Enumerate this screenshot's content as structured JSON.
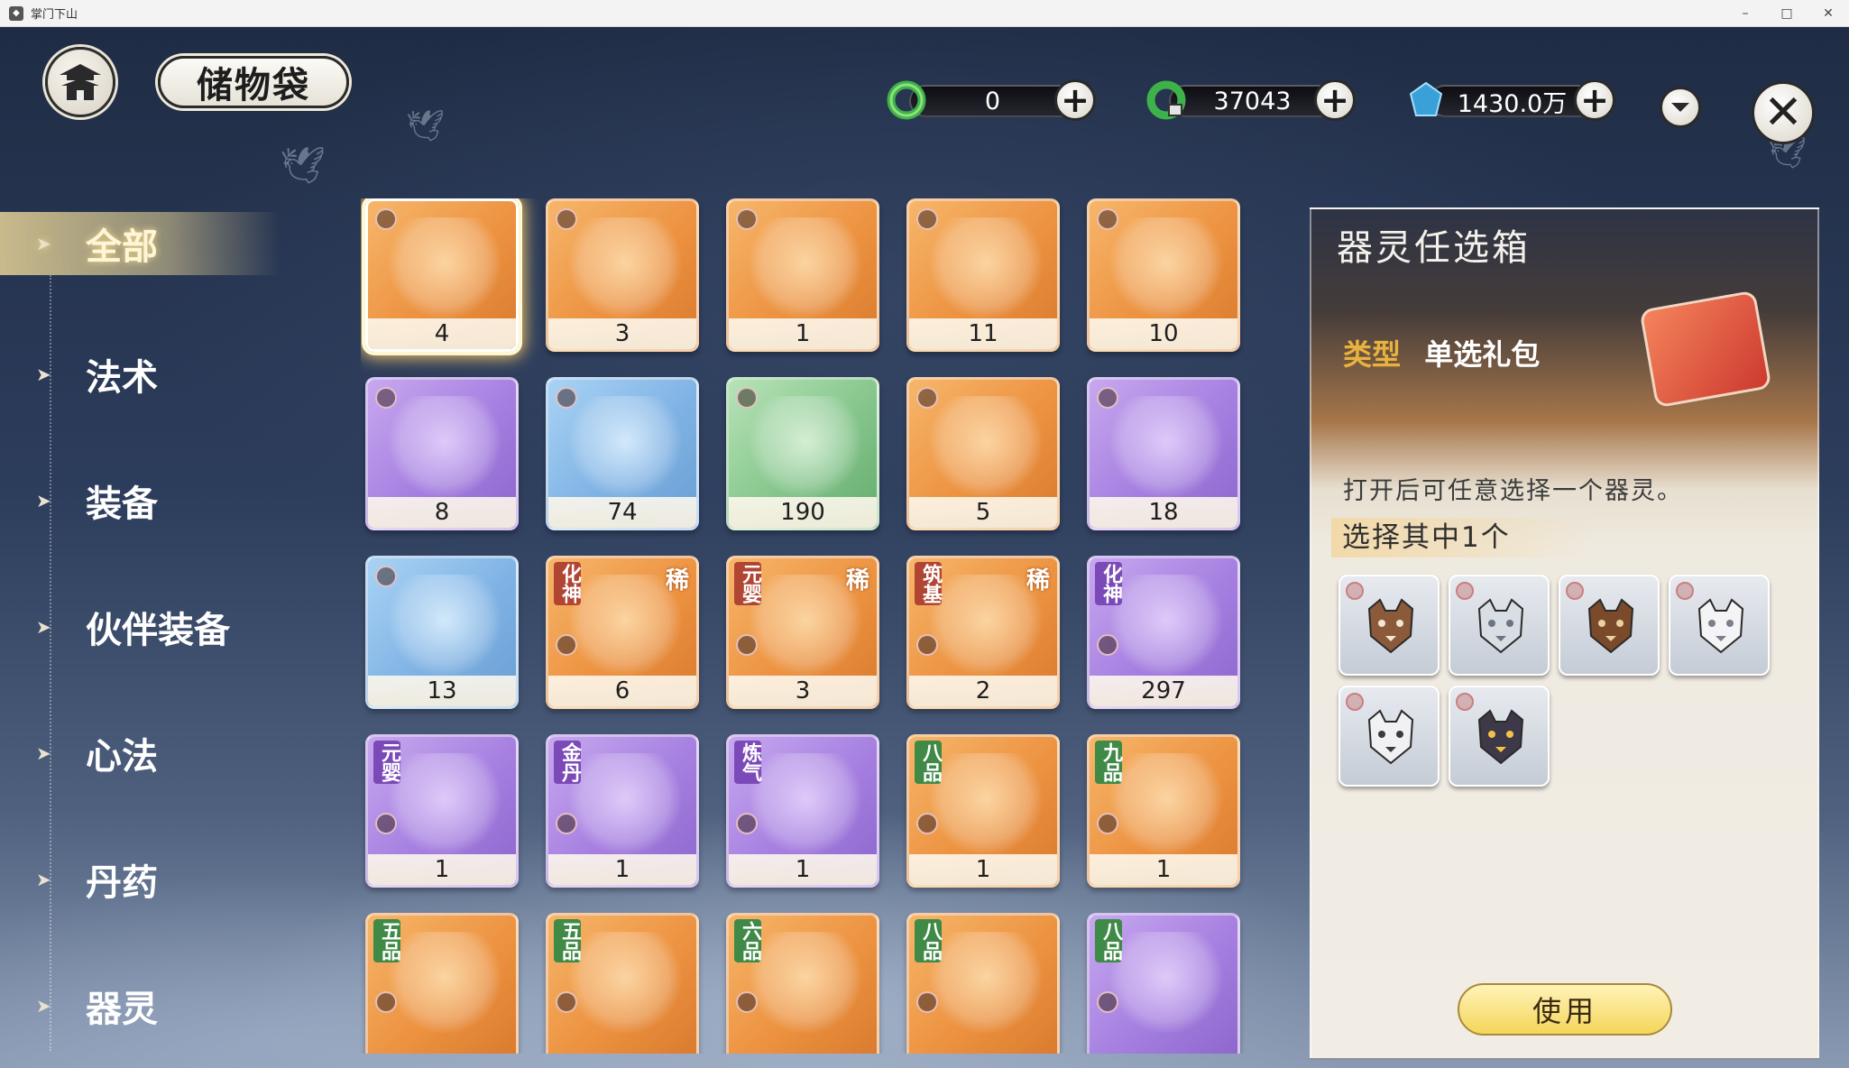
{
  "window": {
    "title": "掌门下山",
    "minimize": "–",
    "maximize": "□",
    "close": "✕"
  },
  "header": {
    "title": "储物袋",
    "currencies": [
      {
        "name": "jade",
        "value": "0"
      },
      {
        "name": "bound-jade",
        "value": "37043"
      },
      {
        "name": "spirit-stone",
        "value": "1430.0万"
      }
    ]
  },
  "sidebar": {
    "items": [
      {
        "label": "全部",
        "active": true
      },
      {
        "label": "法术"
      },
      {
        "label": "装备"
      },
      {
        "label": "伙伴装备"
      },
      {
        "label": "心法"
      },
      {
        "label": "丹药"
      },
      {
        "label": "器灵"
      }
    ]
  },
  "grid": {
    "items": [
      {
        "count": "4",
        "color": "orange",
        "tag": "",
        "rare": "",
        "selected": true
      },
      {
        "count": "3",
        "color": "orange",
        "tag": "",
        "rare": ""
      },
      {
        "count": "1",
        "color": "orange",
        "tag": "",
        "rare": ""
      },
      {
        "count": "11",
        "color": "orange",
        "tag": "",
        "rare": ""
      },
      {
        "count": "10",
        "color": "orange",
        "tag": "",
        "rare": ""
      },
      {
        "count": "8",
        "color": "purple",
        "tag": "",
        "rare": ""
      },
      {
        "count": "74",
        "color": "blue",
        "tag": "",
        "rare": ""
      },
      {
        "count": "190",
        "color": "green",
        "tag": "",
        "rare": ""
      },
      {
        "count": "5",
        "color": "orange",
        "tag": "",
        "rare": ""
      },
      {
        "count": "18",
        "color": "purple",
        "tag": "",
        "rare": ""
      },
      {
        "count": "13",
        "color": "blue",
        "tag": "",
        "rare": ""
      },
      {
        "count": "6",
        "color": "orange",
        "tag": "化神",
        "rare": "稀"
      },
      {
        "count": "3",
        "color": "orange",
        "tag": "元婴",
        "rare": "稀"
      },
      {
        "count": "2",
        "color": "orange",
        "tag": "筑基",
        "rare": "稀"
      },
      {
        "count": "297",
        "color": "purple",
        "tag": "化神",
        "rare": ""
      },
      {
        "count": "1",
        "color": "purple",
        "tag": "元婴",
        "rare": ""
      },
      {
        "count": "1",
        "color": "purple",
        "tag": "金丹",
        "rare": ""
      },
      {
        "count": "1",
        "color": "purple",
        "tag": "炼气",
        "rare": ""
      },
      {
        "count": "1",
        "color": "orange",
        "tag": "八品",
        "rare": ""
      },
      {
        "count": "1",
        "color": "orange",
        "tag": "九品",
        "rare": ""
      },
      {
        "count": "",
        "color": "orange",
        "tag": "五品",
        "rare": ""
      },
      {
        "count": "",
        "color": "orange",
        "tag": "五品",
        "rare": ""
      },
      {
        "count": "",
        "color": "orange",
        "tag": "六品",
        "rare": ""
      },
      {
        "count": "",
        "color": "orange",
        "tag": "八品",
        "rare": ""
      },
      {
        "count": "",
        "color": "purple",
        "tag": "八品",
        "rare": ""
      }
    ]
  },
  "detail": {
    "title": "器灵任选箱",
    "type_key": "类型",
    "type_value": "单选礼包",
    "description": "打开后可任意选择一个器灵。",
    "choose_label": "选择其中1个",
    "use_button": "使用",
    "options": [
      {
        "icon": "eagle-icon"
      },
      {
        "icon": "wolf-icon"
      },
      {
        "icon": "bull-icon"
      },
      {
        "icon": "fox-icon"
      },
      {
        "icon": "tiger-icon"
      },
      {
        "icon": "cat-icon"
      }
    ]
  },
  "colors": {
    "orange_tile": "#ec9240",
    "purple_tile": "#a57ee0",
    "blue_tile": "#7fb2e4",
    "green_tile": "#85c58b",
    "highlight_gold": "#f5c867",
    "type_key": "#e8b33c"
  }
}
